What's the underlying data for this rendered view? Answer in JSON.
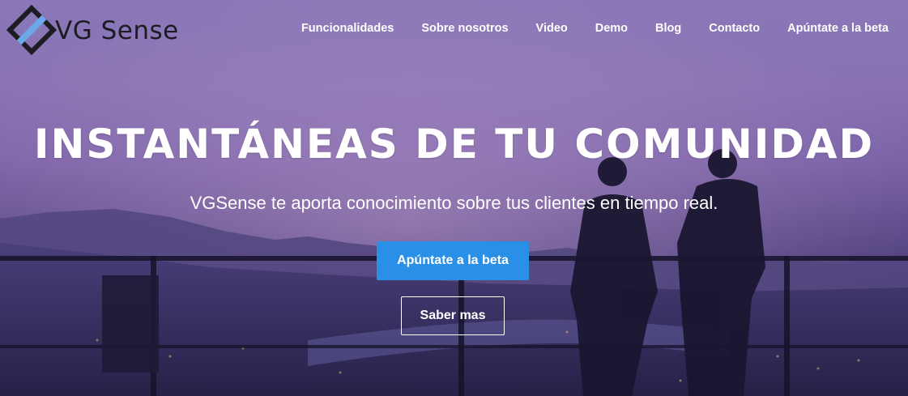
{
  "brand": {
    "name": "VG Sense"
  },
  "nav": {
    "items": [
      {
        "label": "Funcionalidades"
      },
      {
        "label": "Sobre nosotros"
      },
      {
        "label": "Video"
      },
      {
        "label": "Demo"
      },
      {
        "label": "Blog"
      },
      {
        "label": "Contacto"
      },
      {
        "label": "Apúntate a la beta"
      }
    ]
  },
  "hero": {
    "title": "INSTANTÁNEAS DE TU COMUNIDAD",
    "subtitle": "VGSense te aporta conocimiento sobre tus clientes en tiempo real.",
    "primary_button": "Apúntate a la beta",
    "secondary_button": "Saber mas",
    "background_icon": "city-dusk-photo"
  },
  "colors": {
    "accent": "#2a8fe6",
    "logo_dark": "#1c1c22",
    "logo_blue": "#6aa8e8",
    "text_light": "#ffffff"
  }
}
